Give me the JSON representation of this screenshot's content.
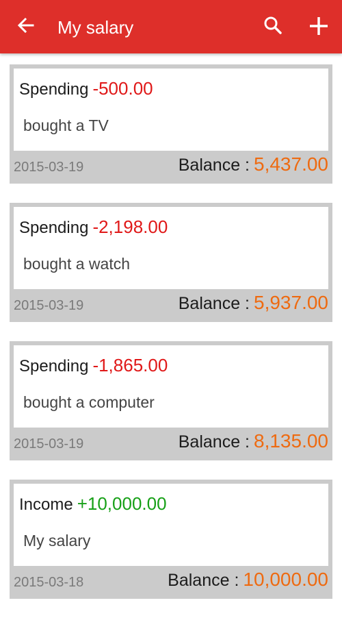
{
  "appbar": {
    "title": "My salary",
    "icons": {
      "back": "arrow-back-icon",
      "search": "search-icon",
      "add": "plus-icon"
    },
    "background_color": "#de2f2a"
  },
  "records": [
    {
      "type": "Spending",
      "amount": "-500.00",
      "kind": "expense",
      "note": "bought a TV",
      "date": "2015-03-19",
      "balance_label": "Balance :",
      "balance": "5,437.00"
    },
    {
      "type": "Spending",
      "amount": "-2,198.00",
      "kind": "expense",
      "note": "bought a watch",
      "date": "2015-03-19",
      "balance_label": "Balance :",
      "balance": "5,937.00"
    },
    {
      "type": "Spending",
      "amount": "-1,865.00",
      "kind": "expense",
      "note": "bought a computer",
      "date": "2015-03-19",
      "balance_label": "Balance :",
      "balance": "8,135.00"
    },
    {
      "type": "Income",
      "amount": "+10,000.00",
      "kind": "income",
      "note": "My salary",
      "date": "2015-03-18",
      "balance_label": "Balance :",
      "balance": "10,000.00"
    }
  ],
  "colors": {
    "expense": "#e01818",
    "income": "#17a017",
    "balance": "#ee6a10"
  }
}
